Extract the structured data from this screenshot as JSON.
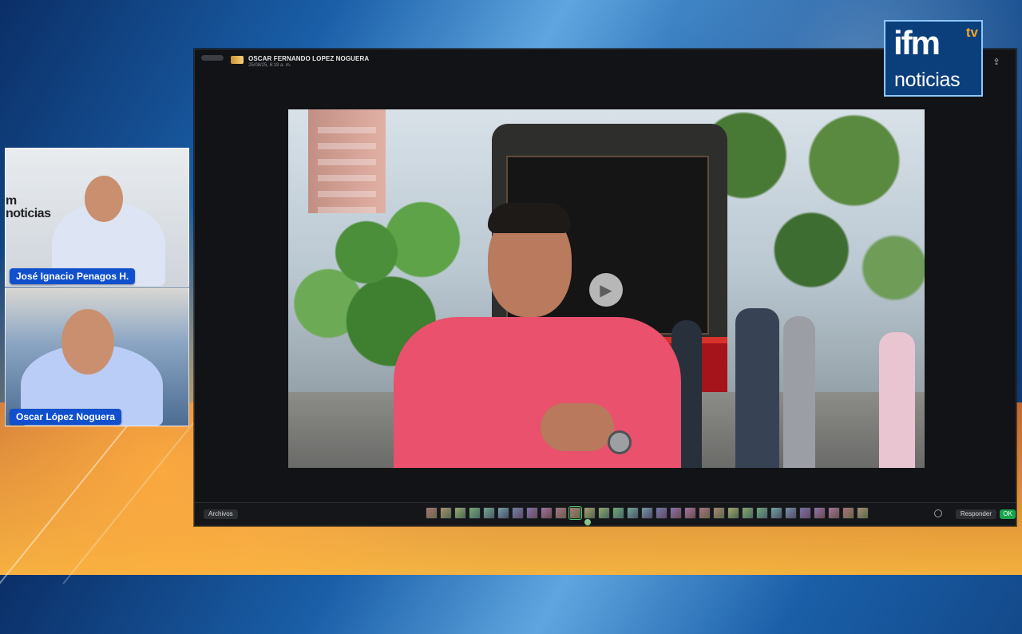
{
  "participants": [
    {
      "name": "José Ignacio Penagos H."
    },
    {
      "name": "Oscar López Noguera"
    }
  ],
  "window": {
    "sender": "OSCAR FERNANDO LOPEZ NOGUERA",
    "timestamp": "25/08/25, 6:19 a. m.",
    "archive_label": "Archivos",
    "reply_label": "Responder",
    "ok_label": "OK",
    "thumbnail_count": 31
  },
  "branding": {
    "main": "ifm",
    "tv": "tv",
    "sub": "noticias"
  },
  "icons": {
    "play": "play-icon",
    "reply": "reply-icon",
    "share": "share-icon",
    "zoom_out": "zoom-out-icon",
    "emoji": "emoji-icon"
  },
  "colors": {
    "name_tag": "#1050cd",
    "ok_button": "#16a34a",
    "brand_blue": "#0b3f7c",
    "brand_orange": "#f4a32a"
  }
}
